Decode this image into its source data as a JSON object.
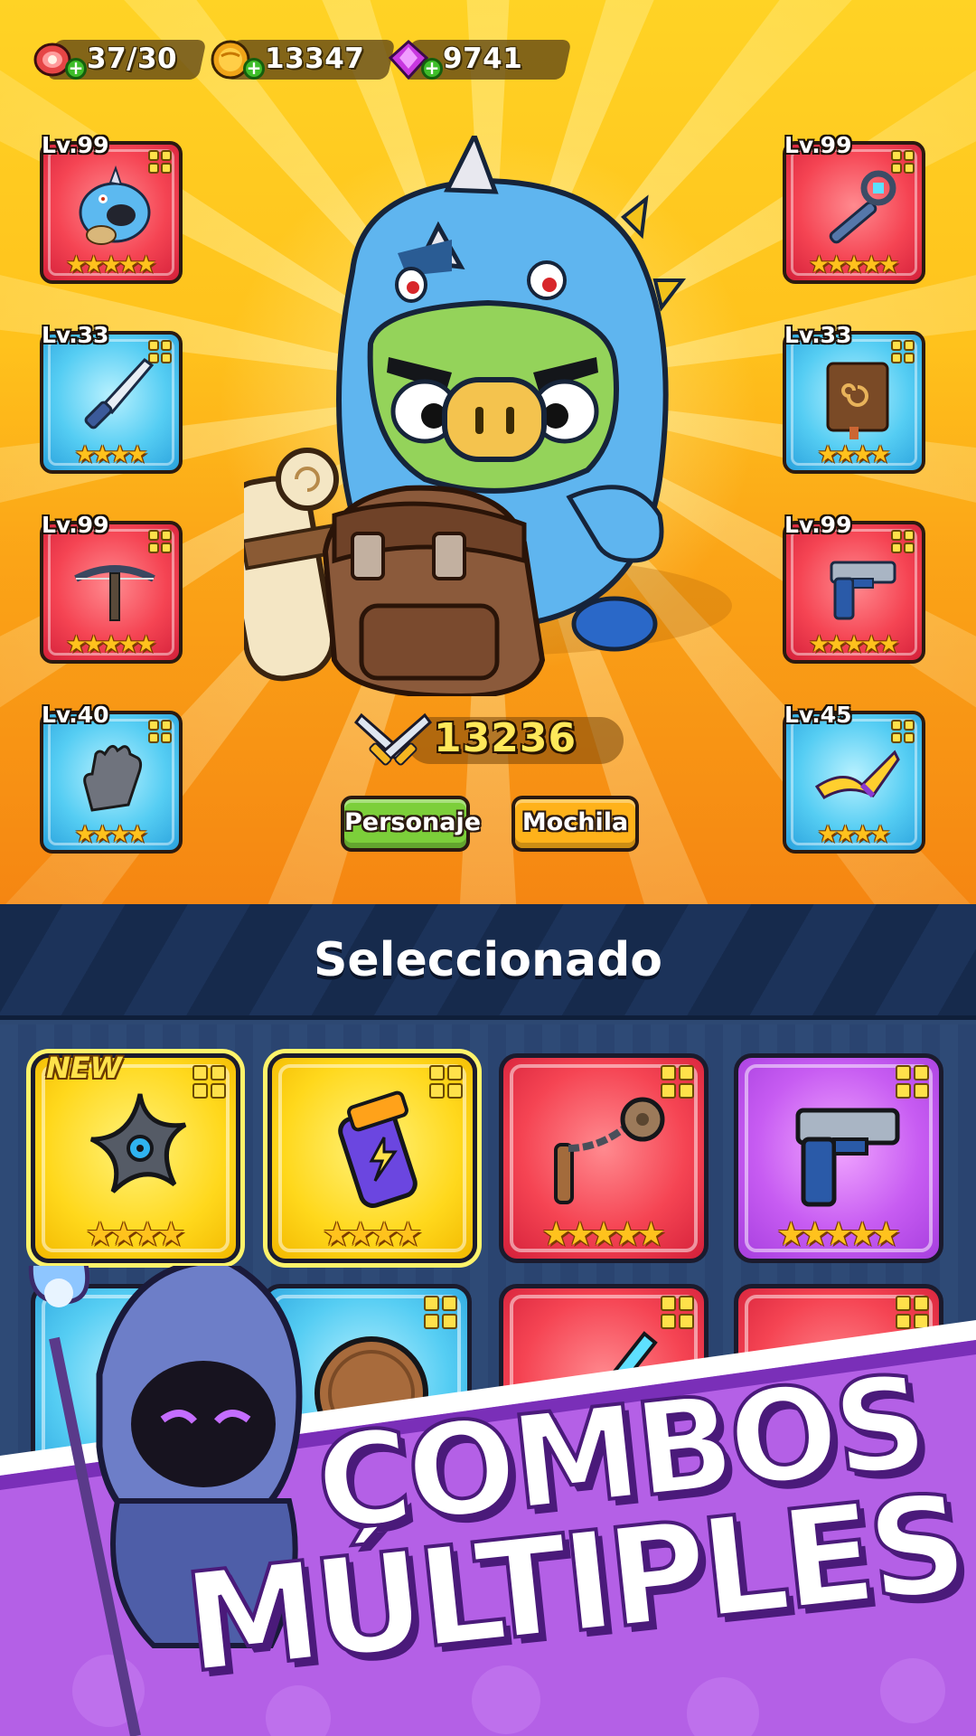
{
  "resources": {
    "energy": {
      "value": "37/30",
      "icon": "meat-icon"
    },
    "coins": {
      "value": "13347",
      "icon": "coin-icon"
    },
    "gems": {
      "value": "9741",
      "icon": "gem-icon"
    }
  },
  "equipment": {
    "left": [
      {
        "level": "Lv.99",
        "item": "blue-dragon-pet",
        "rarity": "red",
        "stars": 5
      },
      {
        "level": "Lv.33",
        "item": "knife",
        "rarity": "blue",
        "stars": 4
      },
      {
        "level": "Lv.99",
        "item": "crossbow",
        "rarity": "red",
        "stars": 5
      },
      {
        "level": "Lv.40",
        "item": "glove",
        "rarity": "blue",
        "stars": 4
      }
    ],
    "right": [
      {
        "level": "Lv.99",
        "item": "wrench-staff",
        "rarity": "red",
        "stars": 5
      },
      {
        "level": "Lv.33",
        "item": "spell-book",
        "rarity": "blue",
        "stars": 4
      },
      {
        "level": "Lv.99",
        "item": "blaster-pistol",
        "rarity": "red",
        "stars": 5
      },
      {
        "level": "Lv.45",
        "item": "boomerang",
        "rarity": "blue",
        "stars": 4
      }
    ]
  },
  "power": "13236",
  "tabs": {
    "character": "Personaje",
    "backpack": "Mochila"
  },
  "panel": {
    "title": "Seleccionado",
    "new_label": "NEW",
    "items": [
      {
        "item": "shuriken",
        "rarity": "yellow",
        "stars": 4,
        "new": true
      },
      {
        "item": "energy-grenade",
        "rarity": "yellow",
        "stars": 4,
        "new": false
      },
      {
        "item": "chain-mace",
        "rarity": "red",
        "stars": 5,
        "new": false
      },
      {
        "item": "blaster-pistol",
        "rarity": "purple",
        "stars": 5,
        "new": false
      },
      {
        "item": "unknown-blue",
        "rarity": "blue",
        "stars": 0,
        "new": false
      },
      {
        "item": "wooden-shield",
        "rarity": "blue",
        "stars": 0,
        "new": false
      },
      {
        "item": "crystal-sword",
        "rarity": "red",
        "stars": 0,
        "new": false
      },
      {
        "item": "gun-barrel",
        "rarity": "red",
        "stars": 0,
        "new": false
      }
    ]
  },
  "banner": {
    "line1": "COMBOS",
    "line2": "MÚLTIPLES"
  },
  "colors": {
    "accent_green": "#7ccf3a",
    "accent_orange": "#ffb21a",
    "panel_bg": "#2d4872",
    "banner_purple": "#b460e6"
  }
}
